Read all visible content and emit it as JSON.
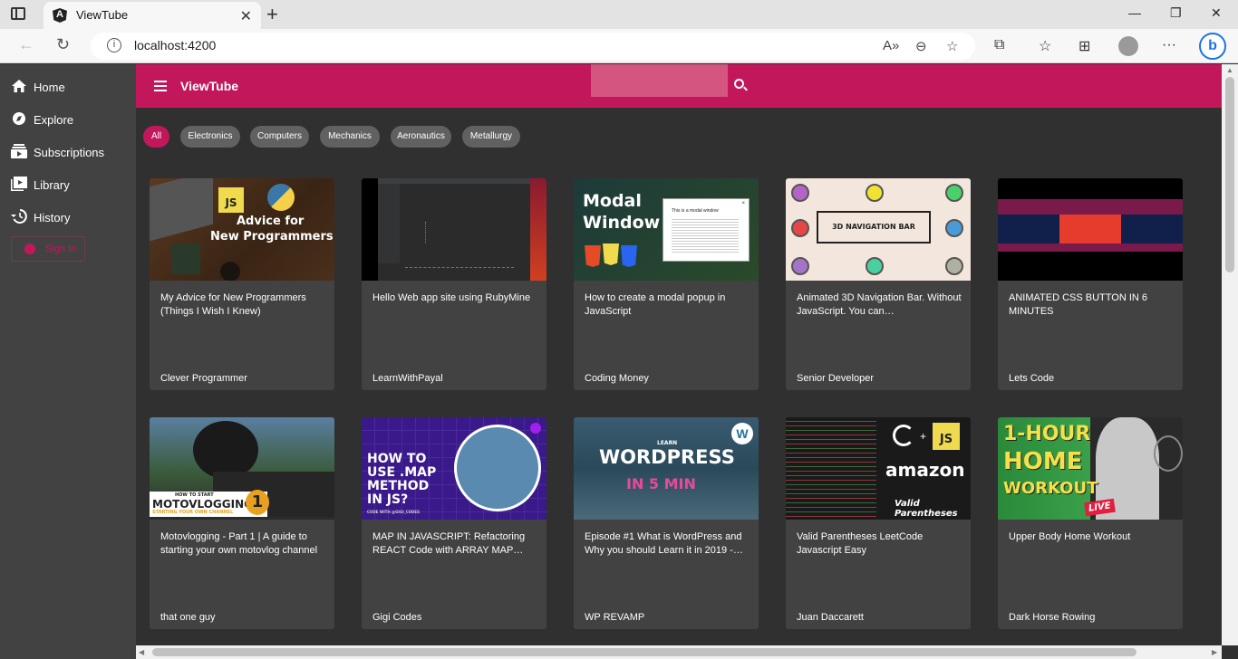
{
  "browser": {
    "tab_title": "ViewTube",
    "url": "localhost:4200"
  },
  "app": {
    "title": "ViewTube",
    "search_placeholder": ""
  },
  "sidebar": {
    "items": [
      {
        "label": "Home",
        "icon": "home-icon"
      },
      {
        "label": "Explore",
        "icon": "compass-icon"
      },
      {
        "label": "Subscriptions",
        "icon": "subscriptions-icon"
      },
      {
        "label": "Library",
        "icon": "library-icon"
      },
      {
        "label": "History",
        "icon": "history-icon"
      }
    ],
    "signin_label": "Sign In"
  },
  "chips": [
    "All",
    "Electronics",
    "Computers",
    "Mechanics",
    "Aeronautics",
    "Metallurgy"
  ],
  "videos": [
    {
      "title": "My Advice for New Programmers (Things I Wish I Knew)",
      "channel": "Clever Programmer",
      "thumb_text": [
        "JS",
        "Advice for",
        "New Programmers"
      ]
    },
    {
      "title": "Hello Web app site using RubyMine",
      "channel": "LearnWithPayal"
    },
    {
      "title": "How to create a modal popup in JavaScript",
      "channel": "Coding Money",
      "thumb_text": [
        "Modal",
        "Window",
        "This is a modal window"
      ]
    },
    {
      "title": "Animated 3D Navigation Bar. Without JavaScript. You can…",
      "channel": "Senior Developer",
      "thumb_text": [
        "3D NAVIGATION BAR"
      ]
    },
    {
      "title": "ANIMATED CSS BUTTON IN 6 MINUTES",
      "channel": "Lets Code"
    },
    {
      "title": "Motovlogging - Part 1 | A guide to starting your own motovlog channel",
      "channel": "that one guy",
      "thumb_text": [
        "HOW TO START",
        "MOTOVLOGGING",
        "1",
        "STARTING YOUR OWN CHANNEL"
      ]
    },
    {
      "title": "MAP IN JAVASCRIPT: Refactoring REACT Code with ARRAY MAP…",
      "channel": "Gigi Codes",
      "thumb_text": [
        "HOW TO",
        "USE .MAP",
        "METHOD",
        "IN JS?",
        "CODE WITH @GIGI_CODES"
      ]
    },
    {
      "title": "Episode #1 What is WordPress and Why you should Learn it in 2019 -…",
      "channel": "WP REVAMP",
      "thumb_text": [
        "LEARN",
        "WORDPRESS",
        "IN 5 MIN"
      ]
    },
    {
      "title": "Valid Parentheses LeetCode Javascript Easy",
      "channel": "Juan Daccarett",
      "thumb_text": [
        "JS",
        "amazon",
        "Valid Parentheses"
      ]
    },
    {
      "title": "Upper Body Home Workout",
      "channel": "Dark Horse Rowing",
      "thumb_text": [
        "1-HOUR",
        "HOME",
        "WORKOUT",
        "LIVE"
      ]
    }
  ],
  "colors": {
    "primary": "#c2185b",
    "sidebar": "#424242",
    "background": "#303030",
    "card": "#424242",
    "chip": "#616161"
  }
}
